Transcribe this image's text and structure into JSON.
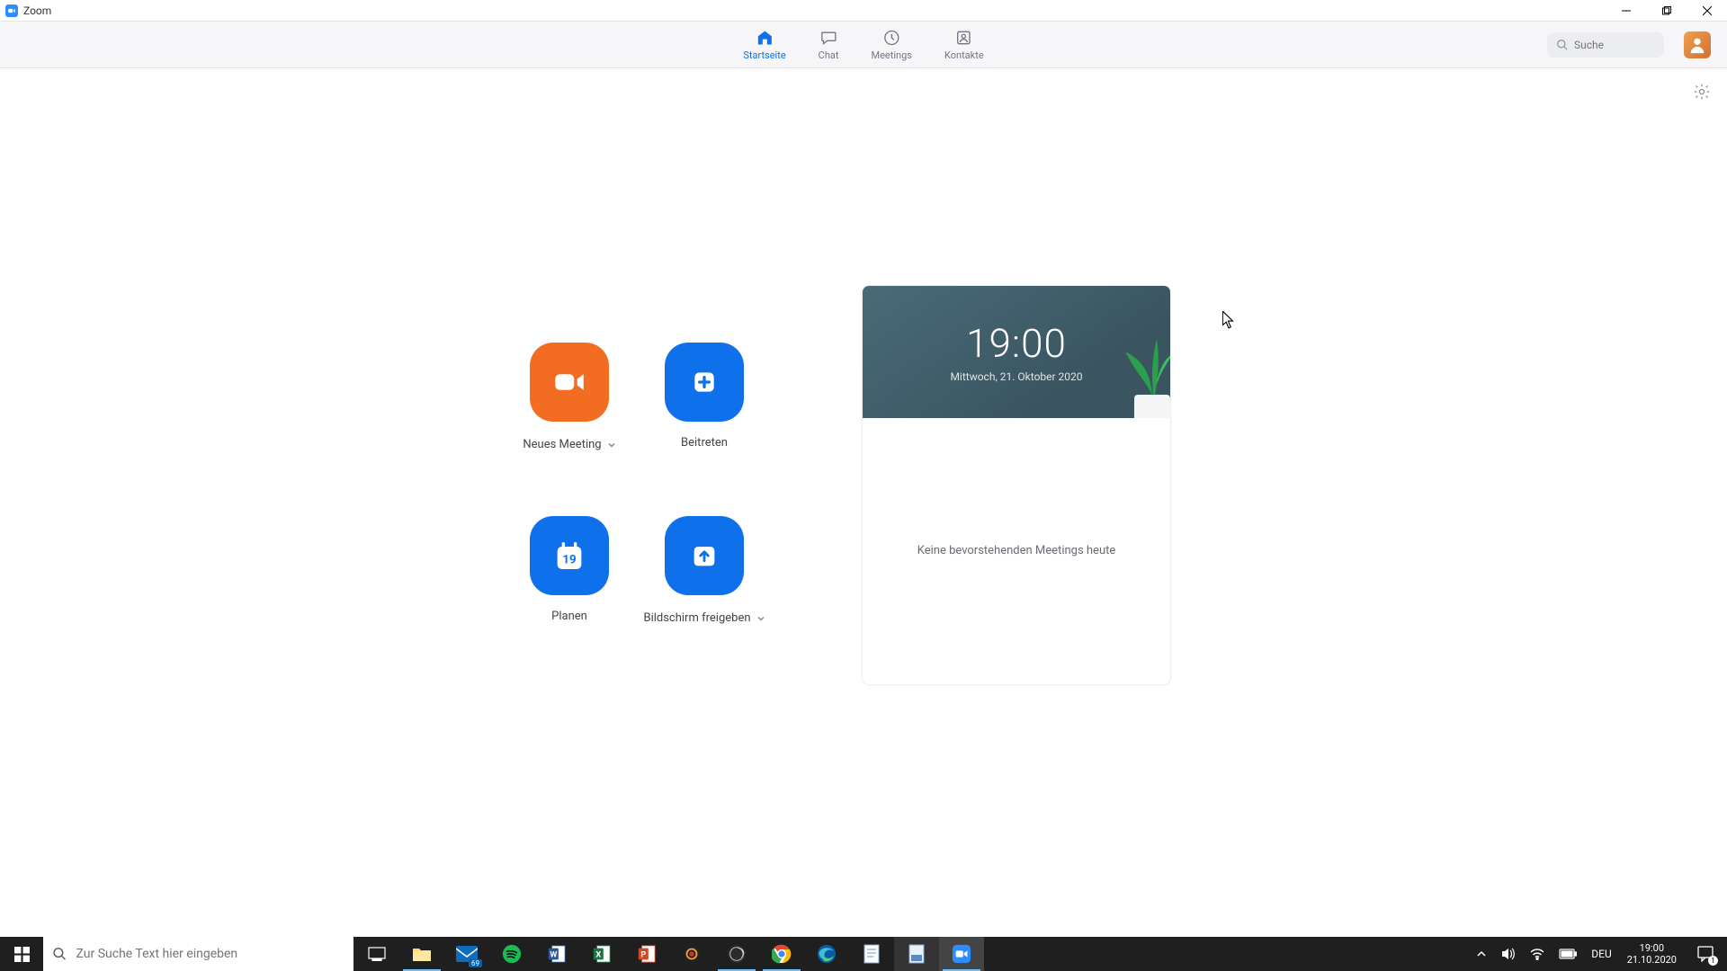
{
  "titlebar": {
    "app_name": "Zoom"
  },
  "nav": {
    "tabs": [
      {
        "label": "Startseite"
      },
      {
        "label": "Chat"
      },
      {
        "label": "Meetings"
      },
      {
        "label": "Kontakte"
      }
    ],
    "search_placeholder": "Suche"
  },
  "actions": {
    "new_meeting": "Neues Meeting",
    "join": "Beitreten",
    "schedule": "Planen",
    "schedule_day": "19",
    "share_screen": "Bildschirm freigeben"
  },
  "calendar": {
    "time": "19:00",
    "date": "Mittwoch, 21. Oktober 2020",
    "empty_text": "Keine bevorstehenden Meetings heute"
  },
  "taskbar": {
    "search_placeholder": "Zur Suche Text hier eingeben",
    "mail_badge": "69",
    "lang": "DEU",
    "clock_time": "19:00",
    "clock_date": "21.10.2020",
    "notif_count": "1"
  }
}
